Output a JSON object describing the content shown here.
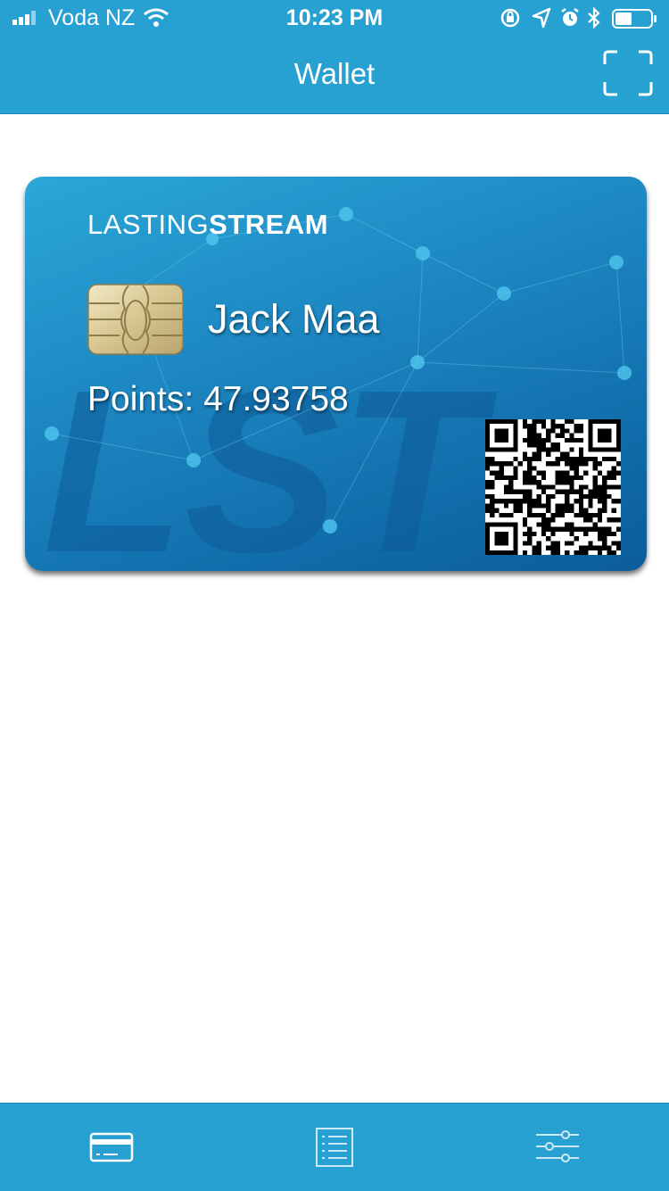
{
  "status_bar": {
    "carrier": "Voda NZ",
    "time": "10:23 PM",
    "icons": [
      "signal-icon",
      "wifi-icon",
      "orientation-lock-icon",
      "location-icon",
      "alarm-icon",
      "bluetooth-icon",
      "battery-icon"
    ]
  },
  "nav": {
    "title": "Wallet",
    "right_icon": "scan-icon"
  },
  "card": {
    "brand_light": "LASTING",
    "brand_bold": "STREAM",
    "holder_name": "Jack Maa",
    "points_text": "Points: 47.93758",
    "watermark": "LST"
  },
  "tabs": [
    {
      "icon": "card-icon",
      "selected": true
    },
    {
      "icon": "list-icon",
      "selected": false
    },
    {
      "icon": "sliders-icon",
      "selected": false
    }
  ],
  "colors": {
    "bar_bg": "#27a0d2",
    "card_top": "#2aa7d8",
    "card_bottom": "#0b5d99",
    "white": "#ffffff"
  }
}
